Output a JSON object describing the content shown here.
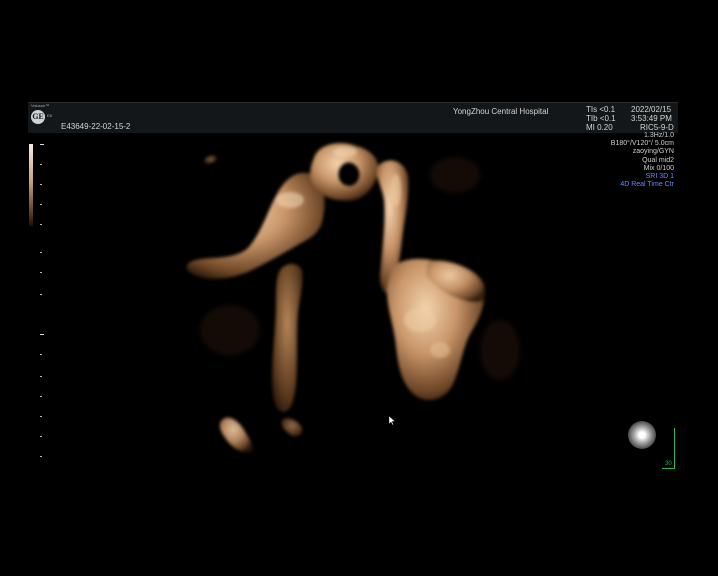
{
  "header": {
    "hospital": "YongZhou Central Hospital",
    "patient_id": "E43649-22-02-15-2",
    "tis": "TIs <0.1",
    "tib": "TIb <0.1",
    "mi": "MI 0.20",
    "date": "2022/02/15",
    "time": "3:53:49 PM",
    "probe": "RIC5-9-D"
  },
  "logo": {
    "brand": "Voluson™",
    "sub": "E8"
  },
  "parameters": [
    "1.3Hz/1.0",
    "B180°/V120°/ 5.0cm",
    "zaoying/GYN",
    "Qual mid2",
    "Mix 0/100"
  ],
  "modes": [
    "SRI 3D 1",
    "4D Real Time Ctr"
  ],
  "frame_label": "30",
  "colors": {
    "tissue": "#c9966a",
    "highlight": "#f1d2ae",
    "shadow": "#3a2312",
    "accent_blue": "#6f86ff",
    "accent_green": "#1db954"
  },
  "icons": [
    "ge-logo-icon",
    "orientation-marker-icon",
    "mouse-pointer-icon"
  ]
}
